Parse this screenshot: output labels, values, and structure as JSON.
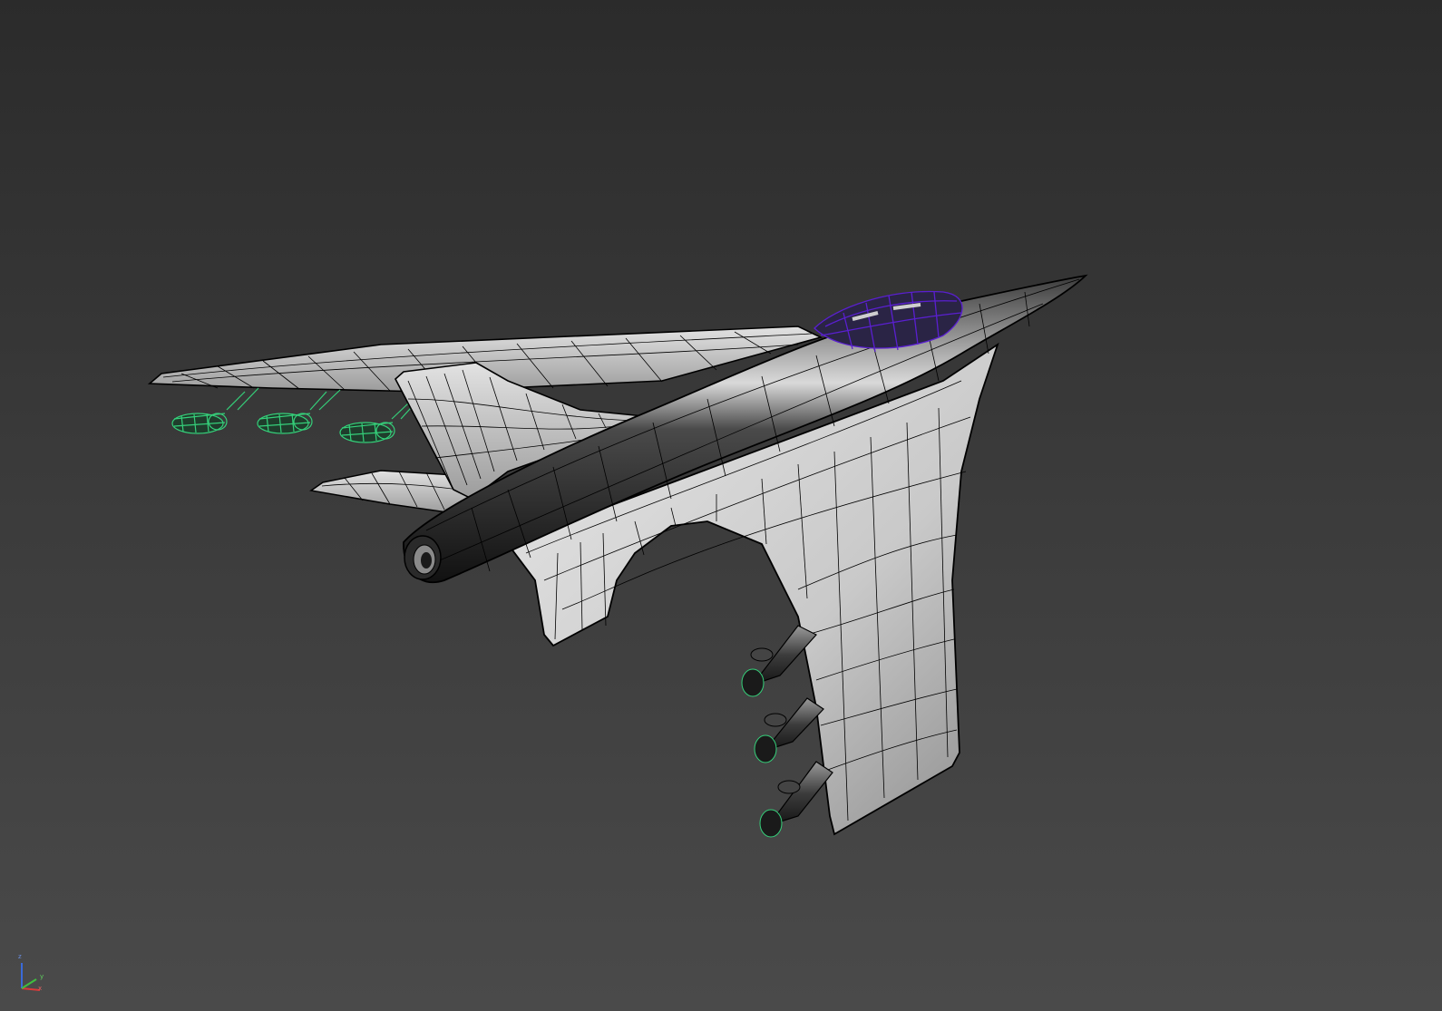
{
  "viewport": {
    "background_top": "#2b2b2b",
    "background_bottom": "#4a4a4a"
  },
  "model": {
    "surface_color": "#cfcfcf",
    "edge_color": "#000000",
    "fuselage_color": "#1c1c1c",
    "canopy_wire_color": "#5a1fd0",
    "selected_pods_wire_color": "#35d07a"
  },
  "gizmo": {
    "x_label": "x",
    "y_label": "y",
    "z_label": "z",
    "x_color": "#d83a3a",
    "y_color": "#3fbf3f",
    "z_color": "#3a6ad8"
  }
}
